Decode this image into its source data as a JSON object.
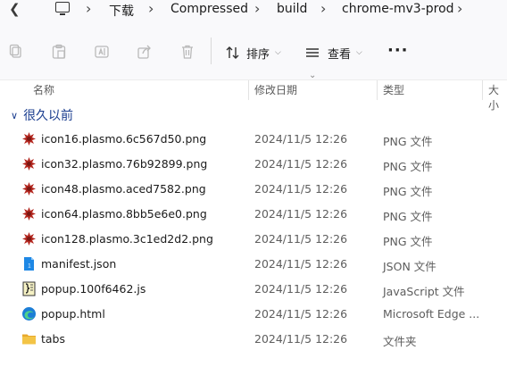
{
  "breadcrumb": {
    "items": [
      "下载",
      "Compressed",
      "build",
      "chrome-mv3-prod"
    ]
  },
  "toolbar": {
    "sort_label": "排序",
    "view_label": "查看",
    "more_label": "···"
  },
  "columns": {
    "name": "名称",
    "date": "修改日期",
    "type": "类型",
    "size": "大小"
  },
  "group": {
    "label": "很久以前"
  },
  "files": [
    {
      "name": "icon16.plasmo.6c567d50.png",
      "date": "2024/11/5 12:26",
      "type": "PNG 文件",
      "icon": "image-file-icon"
    },
    {
      "name": "icon32.plasmo.76b92899.png",
      "date": "2024/11/5 12:26",
      "type": "PNG 文件",
      "icon": "image-file-icon"
    },
    {
      "name": "icon48.plasmo.aced7582.png",
      "date": "2024/11/5 12:26",
      "type": "PNG 文件",
      "icon": "image-file-icon"
    },
    {
      "name": "icon64.plasmo.8bb5e6e0.png",
      "date": "2024/11/5 12:26",
      "type": "PNG 文件",
      "icon": "image-file-icon"
    },
    {
      "name": "icon128.plasmo.3c1ed2d2.png",
      "date": "2024/11/5 12:26",
      "type": "PNG 文件",
      "icon": "image-file-icon"
    },
    {
      "name": "manifest.json",
      "date": "2024/11/5 12:26",
      "type": "JSON 文件",
      "icon": "json-file-icon"
    },
    {
      "name": "popup.100f6462.js",
      "date": "2024/11/5 12:26",
      "type": "JavaScript 文件",
      "icon": "js-file-icon"
    },
    {
      "name": "popup.html",
      "date": "2024/11/5 12:26",
      "type": "Microsoft Edge ...",
      "icon": "edge-html-icon"
    },
    {
      "name": "tabs",
      "date": "2024/11/5 12:26",
      "type": "文件夹",
      "icon": "folder-icon"
    }
  ],
  "colors": {
    "group_header": "#1a3d8f",
    "png_icon": "#b3261e",
    "json_icon": "#1e88e5",
    "folder": "#f3c446"
  }
}
